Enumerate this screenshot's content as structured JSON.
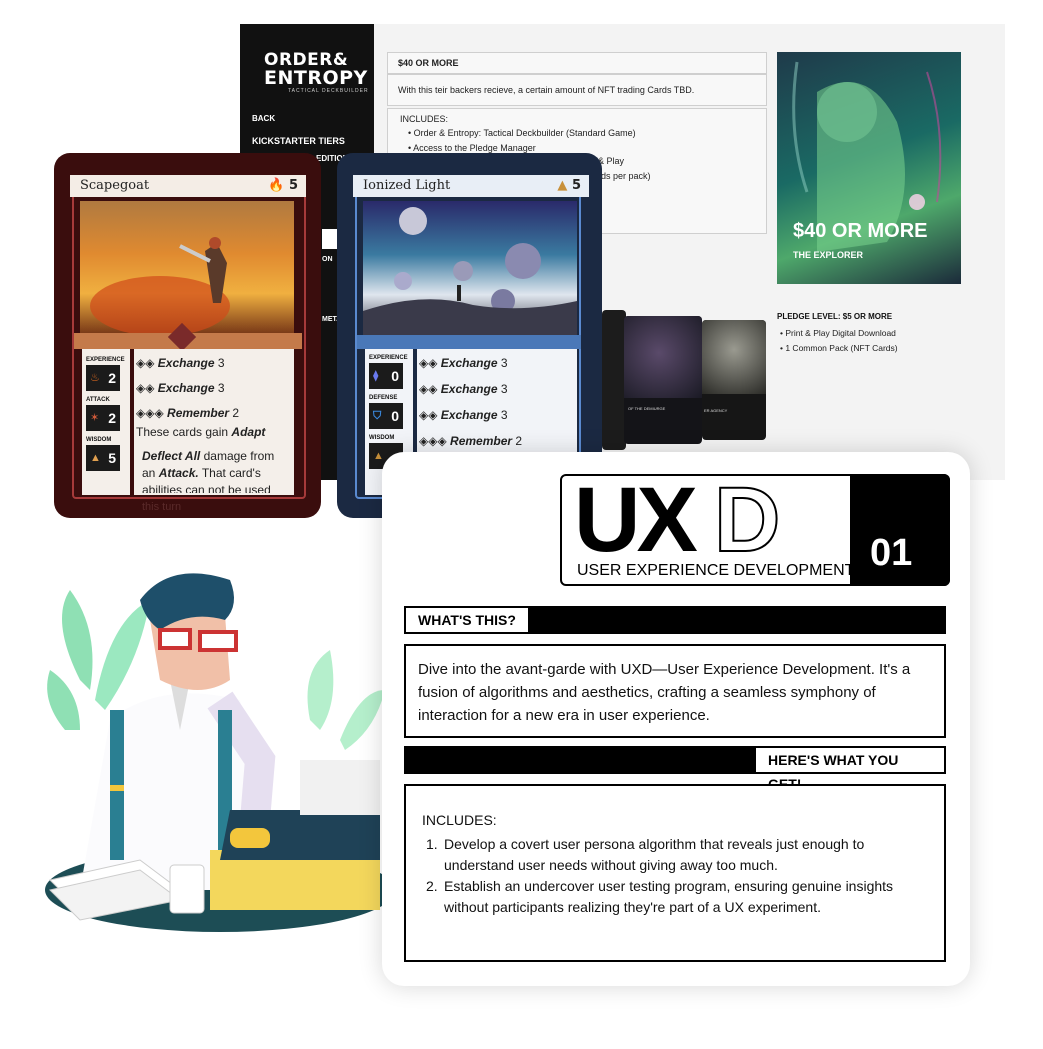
{
  "kickstarter_page": {
    "logo_line1": "ORDER&",
    "logo_line2": "ENTROPY",
    "logo_tagline": "TACTICAL DECKBUILDER",
    "nav": {
      "back": "BACK",
      "tiers": "KICKSTARTER TIERS",
      "edition": "EDITION",
      "item_on": "ON",
      "item_meta": "META"
    },
    "tier_title": "$40 OR MORE",
    "tier_desc": "With this teir backers recieve, a certain amount of NFT trading Cards TBD.",
    "includes_label": "INCLUDES:",
    "includes": [
      "Order & Entropy: Tactical Deckbuilder (Standard Game)",
      "Access to the Pledge Manager",
      "& Play",
      "rds per pack)"
    ],
    "hero_price": "$40 OR MORE",
    "hero_name": "THE EXPLORER",
    "pledge_title": "PLEDGE LEVEL: $5 OR MORE",
    "pledge_items": [
      "Print & Play Digital Download",
      "1 Common Pack (NFT Cards)"
    ],
    "mini_card_texts": [
      "OF THE DEMIURGE",
      "ER AGENCY"
    ]
  },
  "card_scapegoat": {
    "title": "Scapegoat",
    "cost": "5",
    "stats": [
      {
        "label": "EXPERIENCE",
        "value": "2"
      },
      {
        "label": "ATTACK",
        "value": "2"
      },
      {
        "label": "WISDOM",
        "value": "5"
      }
    ],
    "abilities": [
      {
        "name": "Exchange",
        "num": "3"
      },
      {
        "name": "Exchange",
        "num": "3"
      },
      {
        "name": "Remember",
        "num": "2"
      }
    ],
    "gain_text": "These cards gain",
    "gain_keyword": "Adapt",
    "deflect_keyword": "Deflect All",
    "deflect_text": "damage from",
    "deflect_line2a": "an",
    "deflect_attack": "Attack.",
    "deflect_line2b": "That card's",
    "deflect_line3": "abilities can not be used",
    "deflect_line4": "this turn"
  },
  "card_ionized": {
    "title": "Ionized Light",
    "cost": "5",
    "stats": [
      {
        "label": "EXPERIENCE",
        "value": "0"
      },
      {
        "label": "DEFENSE",
        "value": "0"
      },
      {
        "label": "WISDOM",
        "value": ""
      }
    ],
    "abilities": [
      {
        "name": "Exchange",
        "num": "3"
      },
      {
        "name": "Exchange",
        "num": "3"
      },
      {
        "name": "Exchange",
        "num": "3"
      },
      {
        "name": "Remember",
        "num": "2"
      }
    ]
  },
  "uxd": {
    "logo_big": "UX",
    "logo_outline": "D",
    "logo_sub": "USER EXPERIENCE DEVELOPMENT",
    "number": "01",
    "whats_this": "WHAT'S THIS?",
    "description_1": "Dive into the avant-garde with UXD—User Experience Development. It's a",
    "description_2": "fusion of algorithms and aesthetics, crafting a seamless symphony of",
    "description_3": "interaction for a new era in user experience.",
    "get_label": "HERE'S WHAT YOU GET!",
    "includes_label": "INCLUDES:",
    "item_1a": "Develop a covert user persona algorithm that reveals just enough to",
    "item_1b": "understand user needs without giving away too much.",
    "item_2a": "Establish an undercover user testing program, ensuring genuine insights",
    "item_2b": "without participants realizing they're part of a UX experiment.",
    "n1": "1.",
    "n2": "2."
  },
  "colors": {
    "black": "#000000",
    "scapegoat_frame": "#3a0d0d",
    "ionized_frame": "#1b2942",
    "teal": "#2a8a9a"
  }
}
